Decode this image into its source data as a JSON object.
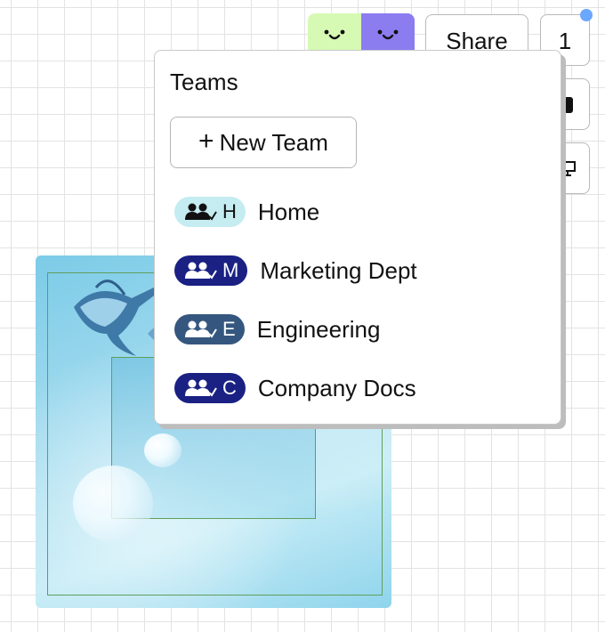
{
  "toolbar": {
    "avatar_colors": [
      "#d6f9b4",
      "#8b7cf0"
    ],
    "share_label": "Share",
    "collaborator_count": "1",
    "notification_color": "#6aa7ff"
  },
  "teams": {
    "title": "Teams",
    "new_team_label": "New Team",
    "items": [
      {
        "initial": "H",
        "name": "Home",
        "badge_color": "#c4ecf1",
        "text_color": "#111111"
      },
      {
        "initial": "M",
        "name": "Marketing Dept",
        "badge_color": "#1a2183",
        "text_color": "#ffffff"
      },
      {
        "initial": "E",
        "name": "Engineering",
        "badge_color": "#35577f",
        "text_color": "#ffffff"
      },
      {
        "initial": "C",
        "name": "Company Docs",
        "badge_color": "#1a2183",
        "text_color": "#ffffff"
      }
    ]
  }
}
